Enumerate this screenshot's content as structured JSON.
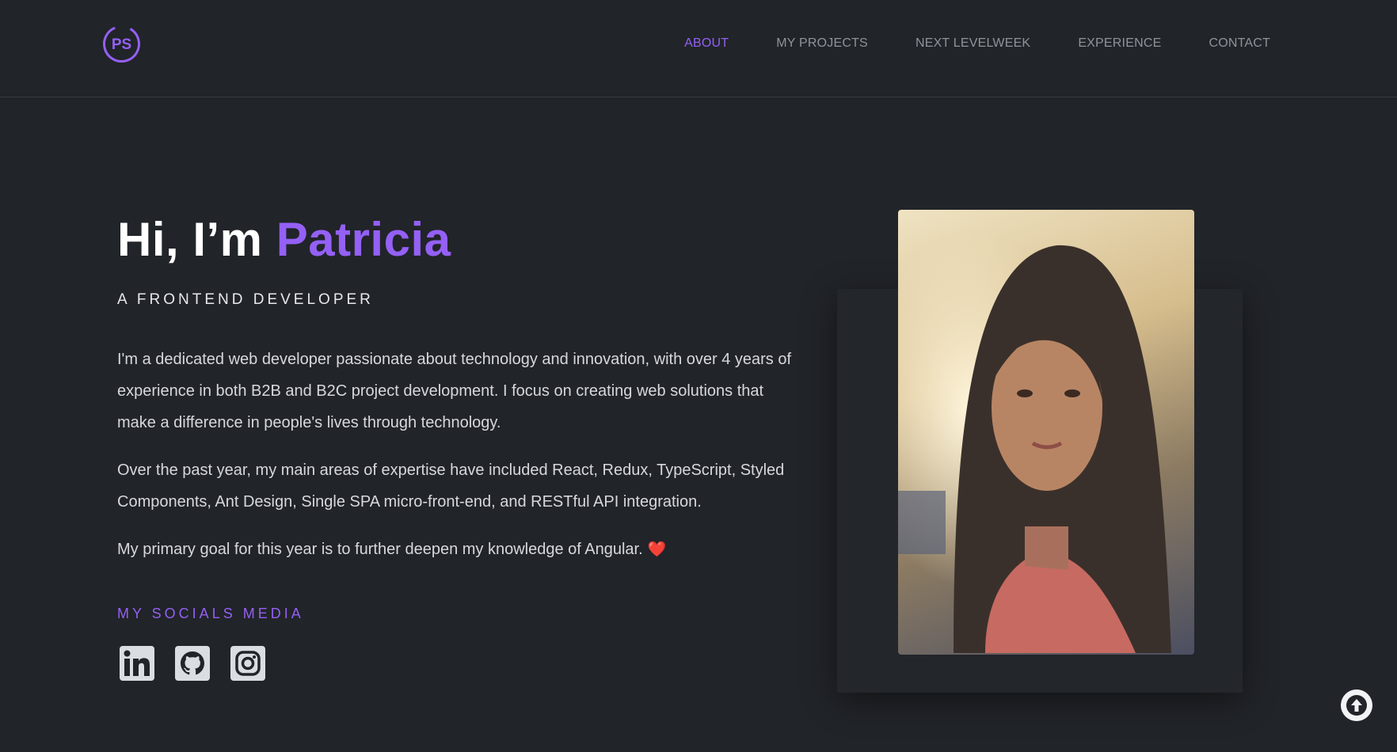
{
  "header": {
    "logo_text": "PS",
    "nav": [
      {
        "label": "ABOUT",
        "active": true
      },
      {
        "label": "MY PROJECTS",
        "active": false
      },
      {
        "label": "NEXT LEVELWEEK",
        "active": false
      },
      {
        "label": "EXPERIENCE",
        "active": false
      },
      {
        "label": "CONTACT",
        "active": false
      }
    ]
  },
  "hero": {
    "greeting": "Hi, I’m",
    "name": "Patricia",
    "subtitle": "A FRONTEND DEVELOPER",
    "paragraphs": [
      "I'm a dedicated web developer passionate about technology and innovation, with over 4 years of experience in both B2B and B2C project development. I focus on creating web solutions that make a difference in people's lives through technology.",
      "Over the past year, my main areas of expertise have included React, Redux, TypeScript, Styled Components, Ant Design, Single SPA micro-front-end, and RESTful API integration.",
      "My primary goal for this year is to further deepen my knowledge of Angular."
    ],
    "heart": "❤️"
  },
  "socials": {
    "title": "MY SOCIALS MEDIA",
    "items": [
      {
        "icon": "linkedin-icon"
      },
      {
        "icon": "github-icon"
      },
      {
        "icon": "instagram-icon"
      }
    ]
  },
  "colors": {
    "accent": "#9460f5",
    "background": "#212429"
  }
}
